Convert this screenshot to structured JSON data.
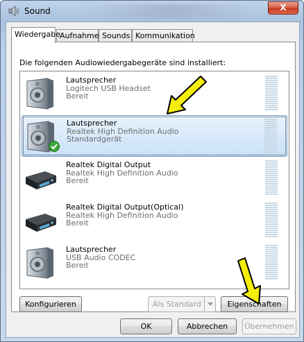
{
  "window": {
    "title": "Sound",
    "close_label": "X"
  },
  "tabs": [
    {
      "label": "Wiedergabe",
      "active": true
    },
    {
      "label": "Aufnahme",
      "active": false
    },
    {
      "label": "Sounds",
      "active": false
    },
    {
      "label": "Kommunikation",
      "active": false
    }
  ],
  "instruction": "Die folgenden Audiowiedergabegeräte sind installiert:",
  "devices": [
    {
      "name": "Lautsprecher",
      "driver": "Logitech USB Headset",
      "status": "Bereit",
      "icon": "speaker-icon",
      "selected": false
    },
    {
      "name": "Lautsprecher",
      "driver": "Realtek High Definition Audio",
      "status": "Standardgerät",
      "icon": "speaker-icon",
      "default_check": "default-device-check-icon",
      "selected": true
    },
    {
      "name": "Realtek Digital Output",
      "driver": "Realtek High Definition Audio",
      "status": "Bereit",
      "icon": "digital-receiver-icon",
      "selected": false
    },
    {
      "name": "Realtek Digital Output(Optical)",
      "driver": "Realtek High Definition Audio",
      "status": "Bereit",
      "icon": "digital-receiver-icon",
      "selected": false
    },
    {
      "name": "Lautsprecher",
      "driver": "USB Audio CODEC",
      "status": "Bereit",
      "icon": "speaker-icon",
      "selected": false
    }
  ],
  "buttons": {
    "configure": "Konfigurieren",
    "set_default": "Als Standard",
    "properties": "Eigenschaften",
    "ok": "OK",
    "cancel": "Abbrechen",
    "apply": "Übernehmen"
  },
  "annotations": {
    "arrow_color": "#f5ee0c",
    "arrow_outline": "#000000"
  }
}
